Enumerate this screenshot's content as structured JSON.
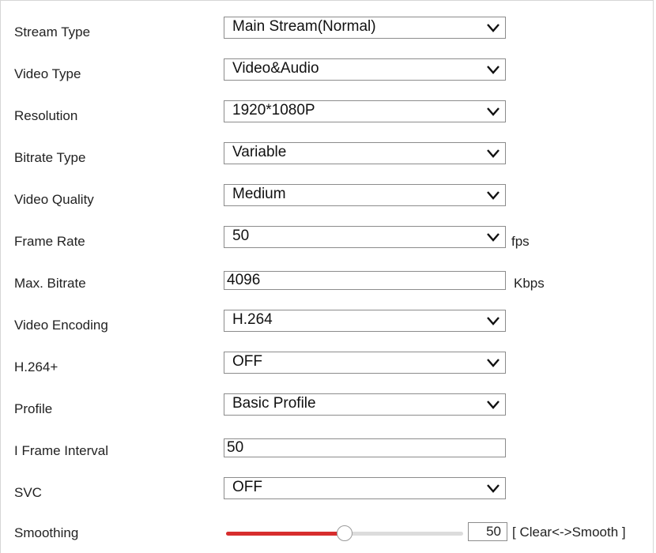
{
  "rows": [
    {
      "label": "Stream Type",
      "value": "Main Stream(Normal)"
    },
    {
      "label": "Video Type",
      "value": "Video&Audio"
    },
    {
      "label": "Resolution",
      "value": "1920*1080P"
    },
    {
      "label": "Bitrate Type",
      "value": "Variable"
    },
    {
      "label": "Video Quality",
      "value": "Medium"
    },
    {
      "label": "Frame Rate",
      "value": "50",
      "unit": "fps"
    },
    {
      "label": "Max. Bitrate",
      "value": "4096",
      "unit": "Kbps"
    },
    {
      "label": "Video Encoding",
      "value": "H.264"
    },
    {
      "label": "H.264+",
      "value": "OFF"
    },
    {
      "label": "Profile",
      "value": "Basic Profile"
    },
    {
      "label": "I Frame Interval",
      "value": "50"
    },
    {
      "label": "SVC",
      "value": "OFF"
    },
    {
      "label": "Smoothing",
      "value": "50",
      "legend": "[ Clear<->Smooth ]"
    }
  ],
  "smoothing_level": 50,
  "colors": {
    "slider_fill": "#d72d2d",
    "slider_track": "#dcdcdc",
    "border": "#8c8c8c"
  },
  "icons": {
    "dropdown": "chevron-down-icon"
  }
}
